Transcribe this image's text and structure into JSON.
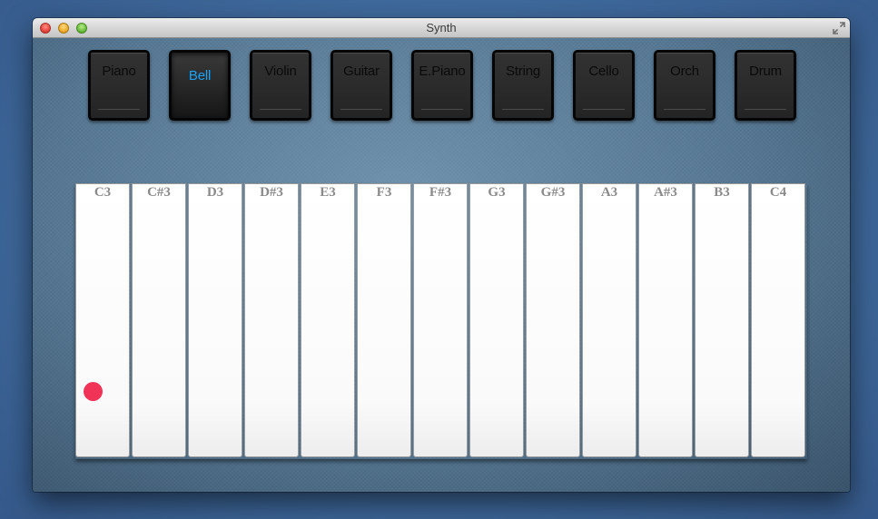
{
  "window": {
    "title": "Synth"
  },
  "instruments": [
    {
      "label": "Piano",
      "active": false
    },
    {
      "label": "Bell",
      "active": true
    },
    {
      "label": "Violin",
      "active": false
    },
    {
      "label": "Guitar",
      "active": false
    },
    {
      "label": "E.Piano",
      "active": false
    },
    {
      "label": "String",
      "active": false
    },
    {
      "label": "Cello",
      "active": false
    },
    {
      "label": "Orch",
      "active": false
    },
    {
      "label": "Drum",
      "active": false
    }
  ],
  "keys": [
    "C3",
    "C#3",
    "D3",
    "D#3",
    "E3",
    "F3",
    "F#3",
    "G3",
    "G#3",
    "A3",
    "A#3",
    "B3",
    "C4"
  ],
  "colors": {
    "active_label": "#1aa3ff",
    "touch_indicator": "#f23358"
  },
  "icons": {
    "close": "close-icon",
    "minimize": "minimize-icon",
    "zoom": "zoom-icon",
    "fullscreen": "fullscreen-icon"
  }
}
